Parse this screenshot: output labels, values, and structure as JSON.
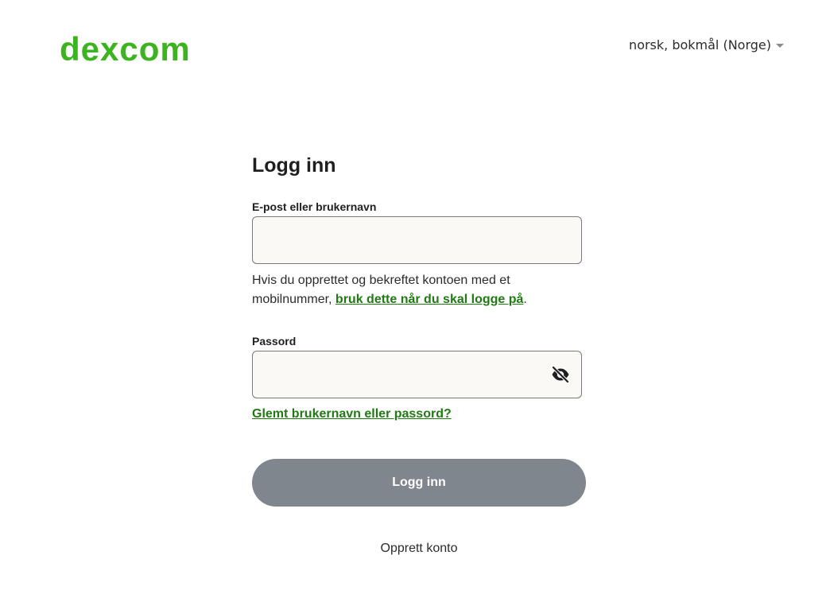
{
  "brand": {
    "name": "dexcom",
    "color": "#3bb41f"
  },
  "header": {
    "language_label": "norsk, bokmål (Norge)"
  },
  "login": {
    "title": "Logg inn",
    "email_label": "E-post eller brukernavn",
    "email_value": "",
    "helper_text": "Hvis du opprettet og bekreftet kontoen med et mobilnummer, ",
    "helper_link": "bruk dette når du skal logge på",
    "helper_end": ".",
    "password_label": "Passord",
    "password_value": "",
    "password_visibility_icon": "eye-off-icon",
    "forgot_link": "Glemt brukernavn eller passord?",
    "submit_label": "Logg inn",
    "create_account": "Opprett konto"
  },
  "colors": {
    "link": "#1f7a12",
    "button_disabled": "#80868d",
    "input_bg": "#faf9f5"
  }
}
